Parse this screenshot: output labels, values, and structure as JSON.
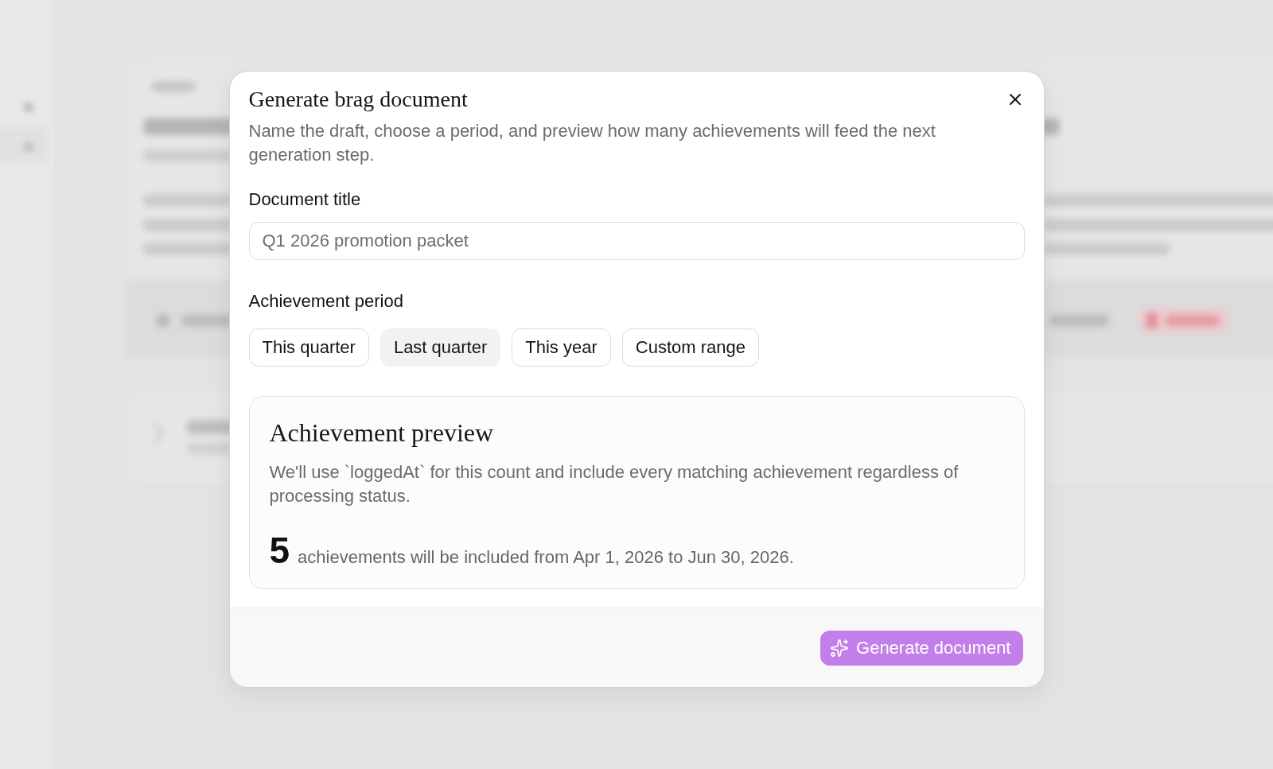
{
  "dialog": {
    "title": "Generate brag document",
    "description": "Name the draft, choose a period, and preview how many achievements will feed the next generation step."
  },
  "title_field": {
    "label": "Document title",
    "placeholder": "Q1 2026 promotion packet"
  },
  "period": {
    "label": "Achievement period",
    "options": [
      {
        "label": "This quarter",
        "selected": false
      },
      {
        "label": "Last quarter",
        "selected": true
      },
      {
        "label": "This year",
        "selected": false
      },
      {
        "label": "Custom range",
        "selected": false
      }
    ]
  },
  "preview": {
    "title": "Achievement preview",
    "note": "We'll use `loggedAt` for this count and include every matching achievement regardless of processing status.",
    "count": "5",
    "summary": "achievements will be included from Apr 1, 2026 to Jun 30, 2026."
  },
  "footer": {
    "primary_button": "Generate document"
  }
}
